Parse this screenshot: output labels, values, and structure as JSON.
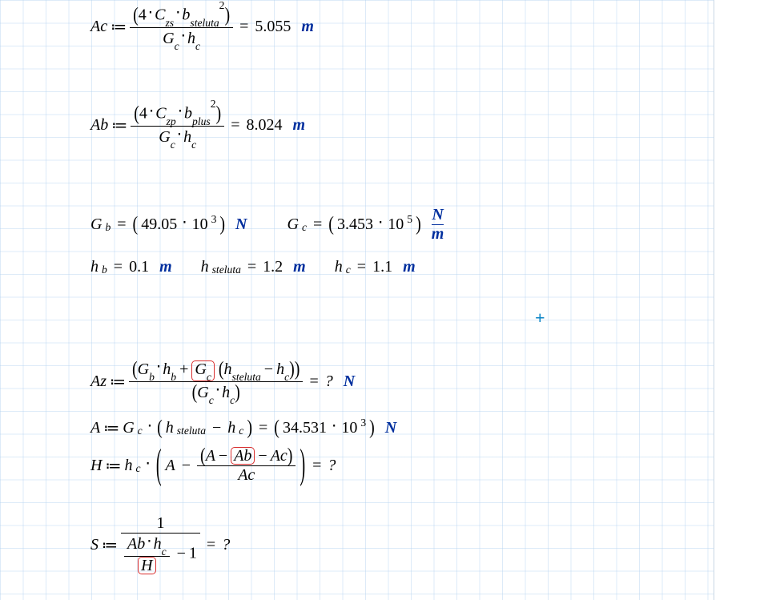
{
  "eqAc": {
    "lhs": "Ac",
    "assign": "≔",
    "four": "4",
    "Czs_sym": "C",
    "Czs_sub": "zs",
    "b_sym": "b",
    "b_sub": "steluta",
    "b_sup": "2",
    "Gc_sym": "G",
    "Gc_sub": "c",
    "hc_sym": "h",
    "hc_sub": "c",
    "val": "5.055",
    "unit": "m"
  },
  "eqAb": {
    "lhs": "Ab",
    "assign": "≔",
    "four": "4",
    "Czp_sym": "C",
    "Czp_sub": "zp",
    "b_sym": "b",
    "b_sub": "plus",
    "b_sup": "2",
    "Gc_sym": "G",
    "Gc_sub": "c",
    "hc_sym": "h",
    "hc_sub": "c",
    "val": "8.024",
    "unit": "m"
  },
  "vals": {
    "Gb_sym": "G",
    "Gb_sub": "b",
    "Gb_val": "49.05",
    "Gb_exp": "3",
    "Gb_unit": "N",
    "Gc_sym": "G",
    "Gc_sub": "c",
    "Gc_val": "3.453",
    "Gc_exp": "5",
    "Gc_unitN": "N",
    "Gc_unitm": "m",
    "hb_sym": "h",
    "hb_sub": "b",
    "hb_val": "0.1",
    "hb_unit": "m",
    "hs_sym": "h",
    "hs_sub": "steluta",
    "hs_val": "1.2",
    "hs_unit": "m",
    "hc_sym": "h",
    "hc_sub": "c",
    "hc_val": "1.1",
    "hc_unit": "m"
  },
  "cursor": "+",
  "eqAz": {
    "lhs": "Az",
    "assign": "≔",
    "Gb": "G",
    "Gb_sub": "b",
    "hb": "h",
    "hb_sub": "b",
    "Gc": "G",
    "Gc_sub": "c",
    "hs": "h",
    "hs_sub": "steluta",
    "hc": "h",
    "hc_sub": "c",
    "result": "?",
    "unit": "N"
  },
  "eqA": {
    "lhs": "A",
    "assign": "≔",
    "Gc": "G",
    "Gc_sub": "c",
    "hs": "h",
    "hs_sub": "steluta",
    "hc": "h",
    "hc_sub": "c",
    "val": "34.531",
    "exp": "3",
    "unit": "N"
  },
  "eqH": {
    "lhs": "H",
    "assign": "≔",
    "hc": "h",
    "hc_sub": "c",
    "A": "A",
    "Ab": "Ab",
    "Ac": "Ac",
    "result": "?"
  },
  "eqS": {
    "lhs": "S",
    "assign": "≔",
    "one": "1",
    "Ab": "Ab",
    "hc": "h",
    "hc_sub": "c",
    "H": "H",
    "minus1": "1",
    "result": "?"
  },
  "ten": "10"
}
